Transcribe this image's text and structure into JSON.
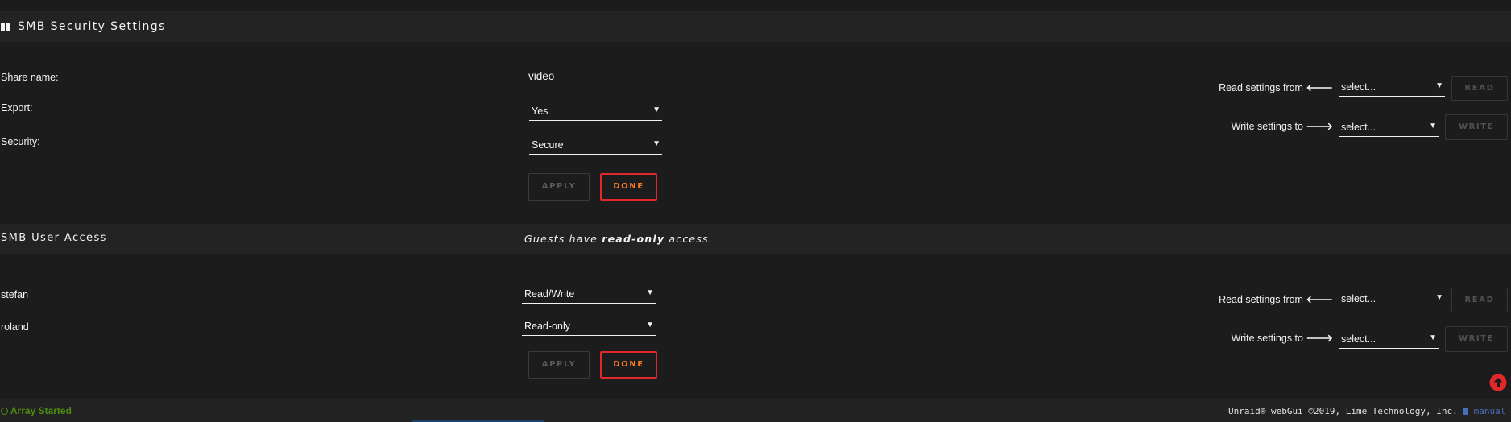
{
  "smb_security": {
    "title": "SMB Security Settings",
    "share_name_label": "Share name:",
    "share_name_value": "video",
    "export_label": "Export:",
    "export_value": "Yes",
    "security_label": "Security:",
    "security_value": "Secure",
    "apply_label": "APPLY",
    "done_label": "DONE",
    "read_from_label": "Read settings from",
    "read_from_value": "select...",
    "read_button": "READ",
    "write_to_label": "Write settings to",
    "write_to_value": "select...",
    "write_button": "WRITE"
  },
  "smb_user_access": {
    "title": "SMB User Access",
    "guest_note_prefix": "Guests have",
    "guest_note_bold": "read-only",
    "guest_note_suffix": "access.",
    "users": [
      {
        "name": "stefan",
        "access": "Read/Write"
      },
      {
        "name": "roland",
        "access": "Read-only"
      }
    ],
    "apply_label": "APPLY",
    "done_label": "DONE",
    "read_from_label": "Read settings from",
    "read_from_value": "select...",
    "read_button": "READ",
    "write_to_label": "Write settings to",
    "write_to_value": "select...",
    "write_button": "WRITE"
  },
  "footer": {
    "status": "Array Started",
    "copyright": "Unraid® webGui ©2019, Lime Technology, Inc.",
    "manual_link": "manual"
  },
  "colors": {
    "background": "#1c1c1c",
    "accent_orange": "#f47a22",
    "done_border": "#e22828",
    "status_green": "#4f8a10",
    "link_blue": "#486dba",
    "scroll_top_red": "#e22828"
  }
}
